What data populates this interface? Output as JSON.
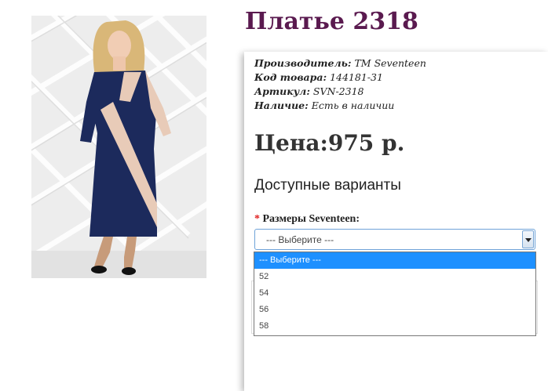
{
  "product": {
    "title": "Платье 2318",
    "image_alt": "dress-photo"
  },
  "meta": {
    "manufacturer_key": "Производитель:",
    "manufacturer_value": "TM Seventeen",
    "code_key": "Код товара:",
    "code_value": "144181-31",
    "article_key": "Артикул:",
    "article_value": "SVN-2318",
    "availability_key": "Наличие:",
    "availability_value": "Есть в наличии"
  },
  "price": {
    "label": "Цена:",
    "value": "975 р."
  },
  "variants": {
    "heading": "Доступные варианты",
    "required_mark": "*",
    "size_label": "Размеры Seventeen:",
    "selected": "--- Выберите ---",
    "options": [
      "--- Выберите ---",
      "52",
      "54",
      "56",
      "58"
    ]
  },
  "colors": {
    "title": "#5a1a4f",
    "dress_navy": "#1c2a5c",
    "dress_beige": "#e8cbb8",
    "select_border": "#6fa3d8",
    "highlight": "#1e90ff"
  }
}
